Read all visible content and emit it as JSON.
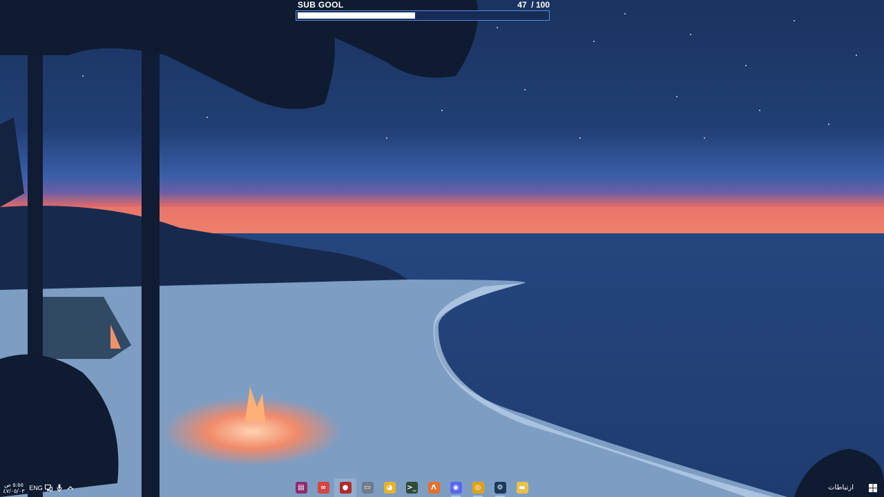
{
  "subgoal": {
    "title": "SUB GOOL",
    "count_text": "47  / 100",
    "current": 47,
    "goal": 100
  },
  "taskbar": {
    "clock_time": "٥:٥٥ ص",
    "clock_date": "٤٧/٠٥/٠٣",
    "language": "ENG",
    "tray_icons": [
      "network-icon",
      "microphone-icon",
      "show-hidden-icons-chevron"
    ],
    "apps": [
      {
        "name": "winrar-icon",
        "glyph": "▤",
        "color": "#8b2c6e",
        "state": "normal"
      },
      {
        "name": "rainbow-circles-app-icon",
        "glyph": "∞",
        "color": "#d64541",
        "state": "normal"
      },
      {
        "name": "dark-red-app-icon",
        "glyph": "●",
        "color": "#b02a2a",
        "state": "active"
      },
      {
        "name": "window-app-icon",
        "glyph": "▭",
        "color": "#6f7c8a",
        "state": "normal"
      },
      {
        "name": "yellow-assistant-icon",
        "glyph": "◕",
        "color": "#e8b32a",
        "state": "normal"
      },
      {
        "name": "terminal-icon",
        "glyph": ">_",
        "color": "#2f4a3a",
        "state": "normal"
      },
      {
        "name": "orange-a-app-icon",
        "glyph": "Λ",
        "color": "#e5712a",
        "state": "normal"
      },
      {
        "name": "discord-icon",
        "glyph": "◉",
        "color": "#5865f2",
        "state": "running"
      },
      {
        "name": "chrome-icon",
        "glyph": "◎",
        "color": "#e0a21b",
        "state": "running"
      },
      {
        "name": "steam-icon",
        "glyph": "⚙",
        "color": "#1b3a5c",
        "state": "running"
      },
      {
        "name": "file-explorer-icon",
        "glyph": "▬",
        "color": "#e8c04a",
        "state": "normal"
      }
    ],
    "contacts_label": "ارتباطات"
  }
}
